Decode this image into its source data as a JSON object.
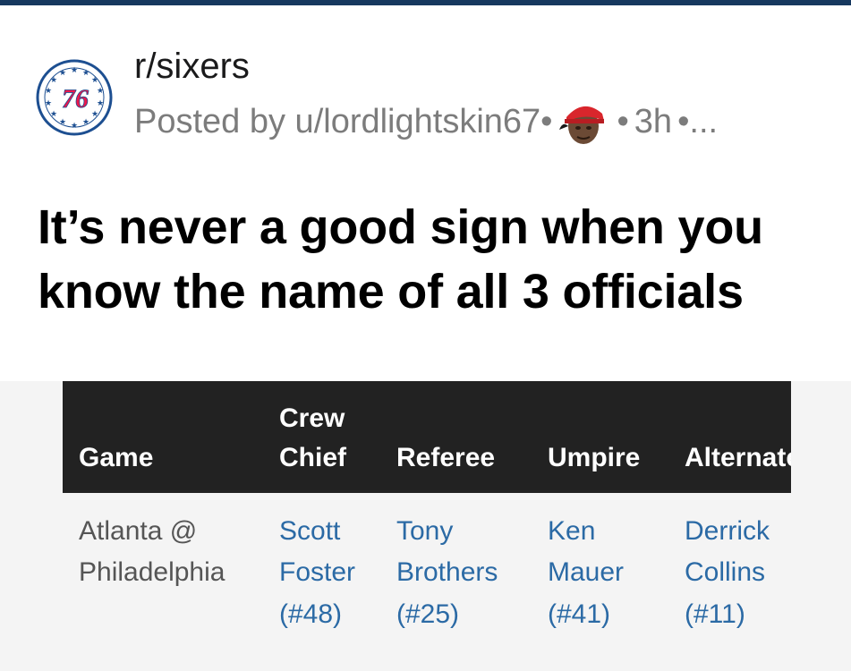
{
  "post": {
    "subreddit": "r/sixers",
    "logo_text": "76",
    "posted_by": "Posted by u/lordlightskin67",
    "sep1": "•",
    "sep2": "•",
    "age": "3h",
    "trailing": "•...",
    "title": "It’s never a good sign when you know the name of all 3 officials"
  },
  "table": {
    "headers": {
      "game": "Game",
      "crew_chief_1": "Crew",
      "crew_chief_2": "Chief",
      "referee": "Referee",
      "umpire": "Umpire",
      "alternate": "Alternate"
    },
    "row": {
      "game_1": "Atlanta @",
      "game_2": "Philadelphia",
      "crew_1": "Scott",
      "crew_2": "Foster",
      "crew_3": "(#48)",
      "ref_1": "Tony",
      "ref_2": "Brothers",
      "ref_3": "(#25)",
      "ump_1": "Ken",
      "ump_2": "Mauer",
      "ump_3": "(#41)",
      "alt_1": "Derrick",
      "alt_2": "Collins",
      "alt_3": "(#11)"
    }
  },
  "colors": {
    "top_bar": "#16385f",
    "header_bg": "#222222",
    "link": "#2b6aa5",
    "meta_text": "#7c7c7c"
  },
  "icons": {
    "subreddit": "sixers-76-logo-icon",
    "user_avatar": "user-avatar-icon"
  }
}
